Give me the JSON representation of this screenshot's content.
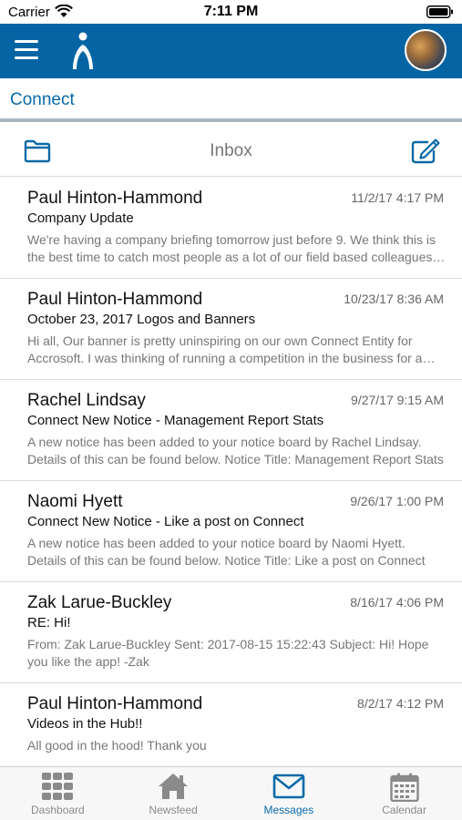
{
  "status_bar": {
    "carrier": "Carrier",
    "time": "7:11 PM"
  },
  "header": {
    "menu_icon": "hamburger-icon",
    "logo_icon": "person-logo-icon",
    "avatar": "user-avatar"
  },
  "connect": {
    "title": "Connect"
  },
  "inbox": {
    "title": "Inbox",
    "folder_icon": "folder-icon",
    "compose_icon": "compose-icon"
  },
  "messages": [
    {
      "sender": "Paul Hinton-Hammond",
      "date": "11/2/17 4:17 PM",
      "subject": "Company Update",
      "preview": "We're having a company briefing tomorrow just before 9. We think this is the best time to catch most people as a lot of our field based colleagues are in the office."
    },
    {
      "sender": "Paul Hinton-Hammond",
      "date": "10/23/17 8:36 AM",
      "subject": "October 23, 2017 Logos and Banners",
      "preview": "Hi all, Our banner is pretty uninspiring on our own Connect Entity for Accrosoft. I was thinking of running a competition in the business for a new design."
    },
    {
      "sender": "Rachel Lindsay",
      "date": "9/27/17 9:15 AM",
      "subject": "Connect New Notice - Management Report Stats",
      "preview": " A new notice has been added to your notice board by Rachel Lindsay. Details of this can be found below. Notice Title: Management Report Stats"
    },
    {
      "sender": "Naomi Hyett",
      "date": "9/26/17 1:00 PM",
      "subject": "Connect New Notice - Like a post on Connect",
      "preview": " A new notice has been added to your notice board by Naomi Hyett. Details of this can be found below. Notice Title: Like a post on Connect"
    },
    {
      "sender": "Zak Larue-Buckley",
      "date": "8/16/17 4:06 PM",
      "subject": "RE: Hi!",
      "preview": "From: Zak Larue-Buckley Sent: 2017-08-15 15:22:43 Subject: Hi! Hope you like the app! -Zak"
    },
    {
      "sender": "Paul Hinton-Hammond",
      "date": "8/2/17 4:12 PM",
      "subject": "Videos in the Hub!!",
      "preview": "All good in the hood! Thank you"
    }
  ],
  "tabs": [
    {
      "label": "Dashboard",
      "icon": "grid-icon",
      "active": false
    },
    {
      "label": "Newsfeed",
      "icon": "home-icon",
      "active": false
    },
    {
      "label": "Messages",
      "icon": "envelope-icon",
      "active": true
    },
    {
      "label": "Calendar",
      "icon": "calendar-icon",
      "active": false
    }
  ],
  "colors": {
    "brand": "#0565a4",
    "accent_text": "#0a6aa8",
    "tab_inactive": "#8a8a8a"
  }
}
